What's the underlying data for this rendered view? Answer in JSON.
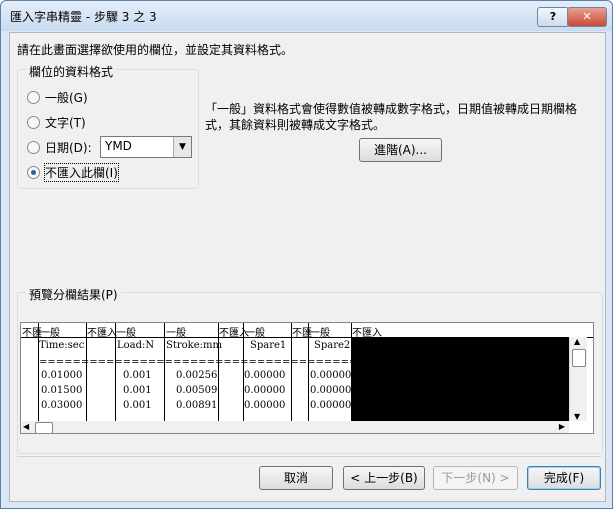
{
  "window": {
    "title": "匯入字串精靈 - 步驟 3 之 3",
    "help_label": "?",
    "close_label": "✕"
  },
  "intro": "請在此畫面選擇欲使用的欄位，並設定其資料格式。",
  "format_group": {
    "label": "欄位的資料格式",
    "general": "一般(G)",
    "text": "文字(T)",
    "date": "日期(D):",
    "skip": "不匯入此欄(I)",
    "date_value": "YMD"
  },
  "description": "「一般」資料格式會使得數值被轉成數字格式，日期值被轉成日期欄格式，其餘資料則被轉成文字格式。",
  "advanced_button": "進階(A)...",
  "preview": {
    "label": "預覽分欄結果(P)",
    "headers": [
      "不匯",
      "一般",
      "不匯入",
      "一般",
      "一般",
      "不匯入",
      "一般",
      "不匯",
      "一般",
      "不匯入"
    ],
    "labels": [
      "Time:sec",
      "Load:N",
      "Stroke:mm",
      "Spare1",
      "Spare2"
    ],
    "rule": "===========================================================",
    "rows": [
      [
        "0.01000",
        "0.001",
        "0.00256",
        "0.00000",
        "0.00000"
      ],
      [
        "0.01500",
        "0.001",
        "0.00509",
        "0.00000",
        "0.00000"
      ],
      [
        "0.03000",
        "0.001",
        "0.00891",
        "0.00000",
        "0.00000"
      ]
    ]
  },
  "buttons": {
    "cancel": "取消",
    "back": "< 上一步(B)",
    "next": "下一步(N) >",
    "finish": "完成(F)"
  }
}
